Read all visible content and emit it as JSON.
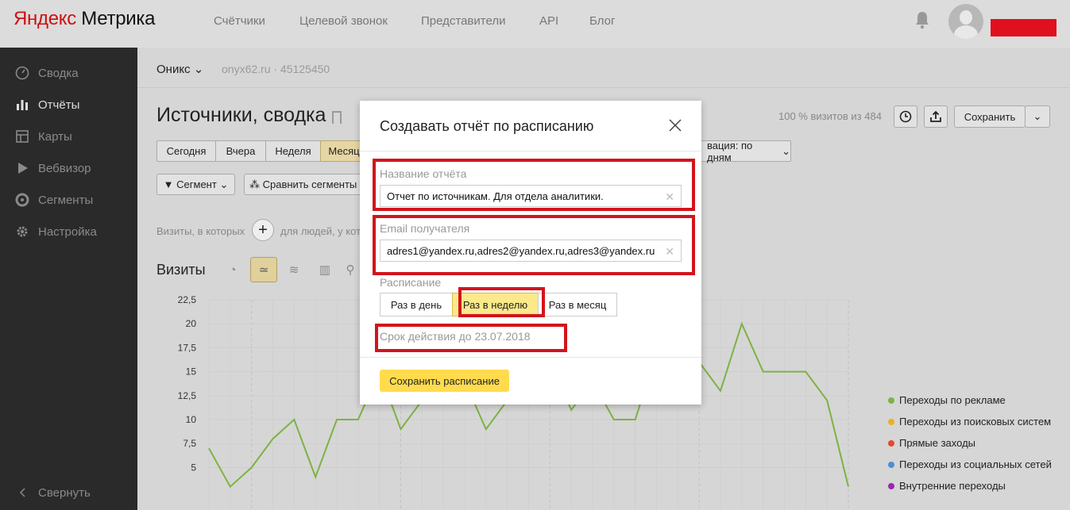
{
  "header": {
    "logo_brand": "Яндекс",
    "logo_product": " Метрика",
    "nav": [
      "Счётчики",
      "Целевой звонок",
      "Представители",
      "API",
      "Блог"
    ]
  },
  "sidebar": {
    "items": [
      {
        "label": "Сводка",
        "icon": "dashboard-icon"
      },
      {
        "label": "Отчёты",
        "icon": "bar-chart-icon"
      },
      {
        "label": "Карты",
        "icon": "map-icon"
      },
      {
        "label": "Вебвизор",
        "icon": "play-icon"
      },
      {
        "label": "Сегменты",
        "icon": "pie-icon"
      },
      {
        "label": "Настройка",
        "icon": "gear-icon"
      }
    ],
    "collapse_label": "Свернуть"
  },
  "main": {
    "counter_name": "Оникс",
    "counter_meta": "onyx62.ru · 45125450",
    "page_title": "Источники, сводка",
    "visits_note": "100 % визитов из 484",
    "save_label": "Сохранить",
    "periods": [
      "Сегодня",
      "Вчера",
      "Неделя",
      "Месяц"
    ],
    "grouping_label": "вация: по дням",
    "segment_label": "Сегмент",
    "compare_label": "Сравнить сегменты",
    "filter_prefix": "Визиты, в которых",
    "filter_suffix": "для людей, у кото",
    "chart_heading": "Визиты"
  },
  "chart_data": {
    "type": "line",
    "y_ticks": [
      "22,5",
      "20",
      "17,5",
      "15",
      "12,5",
      "10",
      "7,5",
      "5"
    ],
    "ylim": [
      5,
      22.5
    ],
    "grid": true,
    "series": [
      {
        "name": "Переходы по рекламе",
        "color": "#7cb342",
        "values": [
          7,
          3,
          5,
          8,
          10,
          4,
          10,
          10,
          15,
          9,
          12,
          16,
          14,
          9,
          12,
          15,
          16,
          11,
          14,
          10,
          10,
          17,
          13,
          16,
          13,
          20,
          15,
          15,
          15,
          12,
          3
        ]
      }
    ],
    "legend": [
      {
        "label": "Переходы по рекламе",
        "color": "#7cb342"
      },
      {
        "label": "Переходы из поисковых систем",
        "color": "#e6b422"
      },
      {
        "label": "Прямые заходы",
        "color": "#e5492d"
      },
      {
        "label": "Переходы из социальных сетей",
        "color": "#4a90d9"
      },
      {
        "label": "Внутренние переходы",
        "color": "#9c27b0"
      }
    ],
    "legend_position": "right"
  },
  "modal": {
    "title": "Создавать отчёт по расписанию",
    "name_label": "Название отчёта",
    "name_value": "Отчет по источникам. Для отдела аналитики.",
    "email_label": "Email получателя",
    "email_value": "adres1@yandex.ru,adres2@yandex.ru,adres3@yandex.ru",
    "schedule_label": "Расписание",
    "schedule_options": [
      "Раз в день",
      "Раз в неделю",
      "Раз в месяц"
    ],
    "schedule_selected": "Раз в неделю",
    "expiry": "Срок действия до 23.07.2018",
    "save_button": "Сохранить расписание"
  },
  "colors": {
    "accent_yellow": "#ffdb4d",
    "highlight_red": "#d2141c",
    "sidebar_bg": "#2a2a2a",
    "chart_line": "#7cb342"
  }
}
